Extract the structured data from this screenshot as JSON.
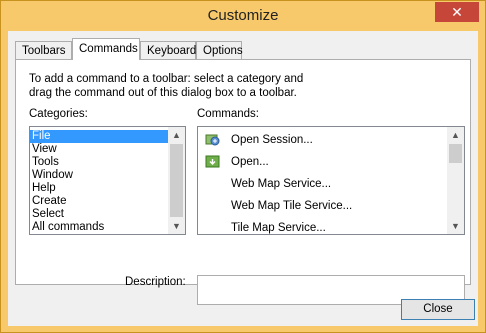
{
  "window": {
    "title": "Customize",
    "close_glyph": "✕"
  },
  "tabs": [
    {
      "label": "Toolbars",
      "active": false
    },
    {
      "label": "Commands",
      "active": true
    },
    {
      "label": "Keyboard",
      "active": false
    },
    {
      "label": "Options",
      "active": false
    }
  ],
  "instruction": "To add a command to a toolbar: select a category and drag the command out of this dialog box to a toolbar.",
  "categories": {
    "label": "Categories:",
    "selected": "File",
    "items": [
      "File",
      "View",
      "Tools",
      "Window",
      "Help",
      "Create",
      "Select",
      "All commands"
    ]
  },
  "commands": {
    "label": "Commands:",
    "items": [
      {
        "label": "Open Session...",
        "icon": "open-session-icon"
      },
      {
        "label": "Open...",
        "icon": "open-icon"
      },
      {
        "label": "Web Map Service...",
        "icon": ""
      },
      {
        "label": "Web Map Tile Service...",
        "icon": ""
      },
      {
        "label": "Tile Map Service...",
        "icon": ""
      }
    ]
  },
  "description": {
    "label": "Description:",
    "value": ""
  },
  "buttons": {
    "close_label": "Close"
  },
  "colors": {
    "title_bar": "#f7c96b",
    "selection": "#3399ff",
    "close_button": "#c7463a"
  }
}
